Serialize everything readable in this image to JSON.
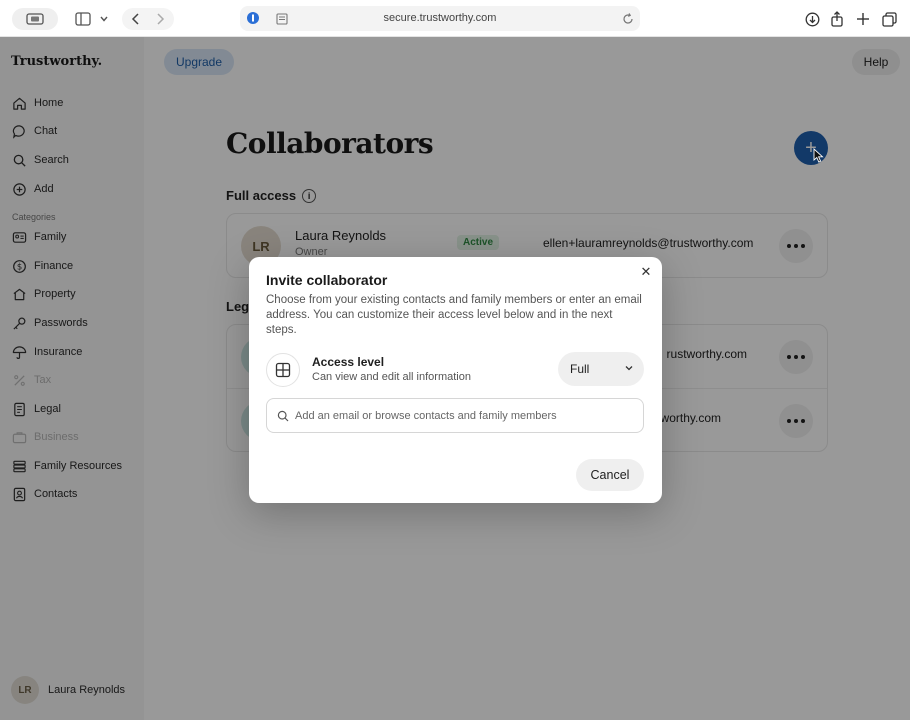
{
  "browser": {
    "url": "secure.trustworthy.com"
  },
  "sidebar": {
    "brand": "Trustworthy.",
    "items": [
      {
        "label": "Home",
        "icon": "home-icon"
      },
      {
        "label": "Chat",
        "icon": "chat-icon"
      },
      {
        "label": "Search",
        "icon": "search-icon"
      },
      {
        "label": "Add",
        "icon": "add-icon"
      }
    ],
    "categories_label": "Categories",
    "categories": [
      {
        "label": "Family",
        "icon": "family-icon",
        "disabled": false
      },
      {
        "label": "Finance",
        "icon": "dollar-icon",
        "disabled": false
      },
      {
        "label": "Property",
        "icon": "house-icon",
        "disabled": false
      },
      {
        "label": "Passwords",
        "icon": "key-icon",
        "disabled": false
      },
      {
        "label": "Insurance",
        "icon": "umbrella-icon",
        "disabled": false
      },
      {
        "label": "Tax",
        "icon": "percent-icon",
        "disabled": true
      },
      {
        "label": "Legal",
        "icon": "document-icon",
        "disabled": false
      },
      {
        "label": "Business",
        "icon": "briefcase-icon",
        "disabled": true
      },
      {
        "label": "Family Resources",
        "icon": "books-icon",
        "disabled": false
      },
      {
        "label": "Contacts",
        "icon": "contact-card-icon",
        "disabled": false
      }
    ],
    "user": {
      "initials": "LR",
      "name": "Laura Reynolds"
    }
  },
  "header": {
    "upgrade_label": "Upgrade",
    "help_label": "Help"
  },
  "page": {
    "title": "Collaborators",
    "full_access_label": "Full access",
    "legacy_label": "Leg",
    "full_access_rows": [
      {
        "initials": "LR",
        "name": "Laura Reynolds",
        "role": "Owner",
        "status": "Active",
        "email": "ellen+lauramreynolds@trustworthy.com"
      }
    ],
    "legacy_rows": [
      {
        "email_suffix": "rustworthy.com"
      },
      {
        "email_suffix": "worthy.com"
      }
    ]
  },
  "modal": {
    "title": "Invite collaborator",
    "description": "Choose from your existing contacts and family members or enter an email address. You can customize their access level below and in the next steps.",
    "access_title": "Access level",
    "access_sub": "Can view and edit all information",
    "access_value": "Full",
    "search_placeholder": "Add an email or browse contacts and family members",
    "search_value": "",
    "cancel_label": "Cancel"
  },
  "colors": {
    "accent": "#1f5fae",
    "active_green": "#2f8a44",
    "upgrade_bg": "#d9e7f7"
  }
}
